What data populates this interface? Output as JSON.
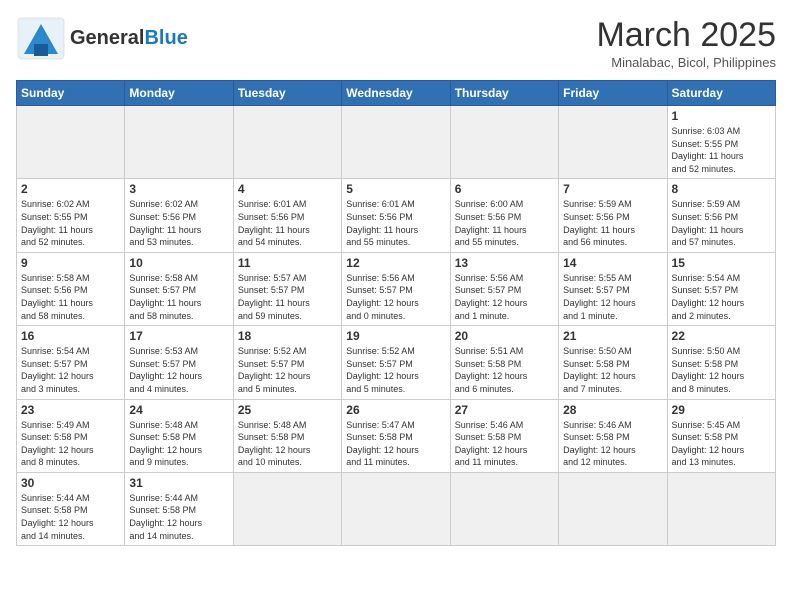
{
  "header": {
    "logo_general": "General",
    "logo_blue": "Blue",
    "month_year": "March 2025",
    "location": "Minalabac, Bicol, Philippines"
  },
  "weekdays": [
    "Sunday",
    "Monday",
    "Tuesday",
    "Wednesday",
    "Thursday",
    "Friday",
    "Saturday"
  ],
  "days": [
    {
      "num": "",
      "info": ""
    },
    {
      "num": "",
      "info": ""
    },
    {
      "num": "",
      "info": ""
    },
    {
      "num": "",
      "info": ""
    },
    {
      "num": "",
      "info": ""
    },
    {
      "num": "",
      "info": ""
    },
    {
      "num": "1",
      "info": "Sunrise: 6:03 AM\nSunset: 5:55 PM\nDaylight: 11 hours\nand 52 minutes."
    },
    {
      "num": "2",
      "info": "Sunrise: 6:02 AM\nSunset: 5:55 PM\nDaylight: 11 hours\nand 52 minutes."
    },
    {
      "num": "3",
      "info": "Sunrise: 6:02 AM\nSunset: 5:56 PM\nDaylight: 11 hours\nand 53 minutes."
    },
    {
      "num": "4",
      "info": "Sunrise: 6:01 AM\nSunset: 5:56 PM\nDaylight: 11 hours\nand 54 minutes."
    },
    {
      "num": "5",
      "info": "Sunrise: 6:01 AM\nSunset: 5:56 PM\nDaylight: 11 hours\nand 55 minutes."
    },
    {
      "num": "6",
      "info": "Sunrise: 6:00 AM\nSunset: 5:56 PM\nDaylight: 11 hours\nand 55 minutes."
    },
    {
      "num": "7",
      "info": "Sunrise: 5:59 AM\nSunset: 5:56 PM\nDaylight: 11 hours\nand 56 minutes."
    },
    {
      "num": "8",
      "info": "Sunrise: 5:59 AM\nSunset: 5:56 PM\nDaylight: 11 hours\nand 57 minutes."
    },
    {
      "num": "9",
      "info": "Sunrise: 5:58 AM\nSunset: 5:56 PM\nDaylight: 11 hours\nand 58 minutes."
    },
    {
      "num": "10",
      "info": "Sunrise: 5:58 AM\nSunset: 5:57 PM\nDaylight: 11 hours\nand 58 minutes."
    },
    {
      "num": "11",
      "info": "Sunrise: 5:57 AM\nSunset: 5:57 PM\nDaylight: 11 hours\nand 59 minutes."
    },
    {
      "num": "12",
      "info": "Sunrise: 5:56 AM\nSunset: 5:57 PM\nDaylight: 12 hours\nand 0 minutes."
    },
    {
      "num": "13",
      "info": "Sunrise: 5:56 AM\nSunset: 5:57 PM\nDaylight: 12 hours\nand 1 minute."
    },
    {
      "num": "14",
      "info": "Sunrise: 5:55 AM\nSunset: 5:57 PM\nDaylight: 12 hours\nand 1 minute."
    },
    {
      "num": "15",
      "info": "Sunrise: 5:54 AM\nSunset: 5:57 PM\nDaylight: 12 hours\nand 2 minutes."
    },
    {
      "num": "16",
      "info": "Sunrise: 5:54 AM\nSunset: 5:57 PM\nDaylight: 12 hours\nand 3 minutes."
    },
    {
      "num": "17",
      "info": "Sunrise: 5:53 AM\nSunset: 5:57 PM\nDaylight: 12 hours\nand 4 minutes."
    },
    {
      "num": "18",
      "info": "Sunrise: 5:52 AM\nSunset: 5:57 PM\nDaylight: 12 hours\nand 5 minutes."
    },
    {
      "num": "19",
      "info": "Sunrise: 5:52 AM\nSunset: 5:57 PM\nDaylight: 12 hours\nand 5 minutes."
    },
    {
      "num": "20",
      "info": "Sunrise: 5:51 AM\nSunset: 5:58 PM\nDaylight: 12 hours\nand 6 minutes."
    },
    {
      "num": "21",
      "info": "Sunrise: 5:50 AM\nSunset: 5:58 PM\nDaylight: 12 hours\nand 7 minutes."
    },
    {
      "num": "22",
      "info": "Sunrise: 5:50 AM\nSunset: 5:58 PM\nDaylight: 12 hours\nand 8 minutes."
    },
    {
      "num": "23",
      "info": "Sunrise: 5:49 AM\nSunset: 5:58 PM\nDaylight: 12 hours\nand 8 minutes."
    },
    {
      "num": "24",
      "info": "Sunrise: 5:48 AM\nSunset: 5:58 PM\nDaylight: 12 hours\nand 9 minutes."
    },
    {
      "num": "25",
      "info": "Sunrise: 5:48 AM\nSunset: 5:58 PM\nDaylight: 12 hours\nand 10 minutes."
    },
    {
      "num": "26",
      "info": "Sunrise: 5:47 AM\nSunset: 5:58 PM\nDaylight: 12 hours\nand 11 minutes."
    },
    {
      "num": "27",
      "info": "Sunrise: 5:46 AM\nSunset: 5:58 PM\nDaylight: 12 hours\nand 11 minutes."
    },
    {
      "num": "28",
      "info": "Sunrise: 5:46 AM\nSunset: 5:58 PM\nDaylight: 12 hours\nand 12 minutes."
    },
    {
      "num": "29",
      "info": "Sunrise: 5:45 AM\nSunset: 5:58 PM\nDaylight: 12 hours\nand 13 minutes."
    },
    {
      "num": "30",
      "info": "Sunrise: 5:44 AM\nSunset: 5:58 PM\nDaylight: 12 hours\nand 14 minutes."
    },
    {
      "num": "31",
      "info": "Sunrise: 5:44 AM\nSunset: 5:58 PM\nDaylight: 12 hours\nand 14 minutes."
    },
    {
      "num": "",
      "info": ""
    },
    {
      "num": "",
      "info": ""
    },
    {
      "num": "",
      "info": ""
    },
    {
      "num": "",
      "info": ""
    },
    {
      "num": "",
      "info": ""
    }
  ]
}
